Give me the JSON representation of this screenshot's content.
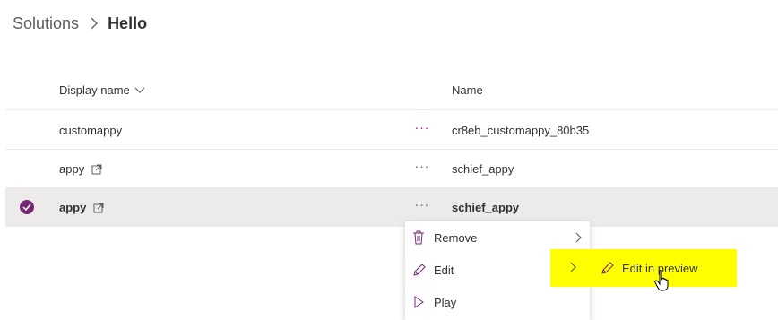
{
  "breadcrumb": {
    "root": "Solutions",
    "current": "Hello"
  },
  "columns": {
    "display_name": "Display name",
    "name": "Name"
  },
  "rows": [
    {
      "display": "customappy",
      "name": "cr8eb_customappy_80b35",
      "external": false,
      "selected": false
    },
    {
      "display": "appy",
      "name": "schief_appy",
      "external": true,
      "selected": false
    },
    {
      "display": "appy",
      "name": "schief_appy",
      "external": true,
      "selected": true
    }
  ],
  "more_label": "···",
  "context_menu": {
    "items": [
      {
        "label": "Remove",
        "icon": "trash-icon",
        "has_submenu": true
      },
      {
        "label": "Edit",
        "icon": "pencil-icon",
        "has_submenu": true
      },
      {
        "label": "Play",
        "icon": "play-icon",
        "has_submenu": false
      }
    ]
  },
  "submenu": {
    "label": "Edit in preview",
    "icon": "pencil-icon"
  },
  "colors": {
    "accent": "#742774",
    "highlight": "#ffff00",
    "more_pink": "#e3008c"
  }
}
